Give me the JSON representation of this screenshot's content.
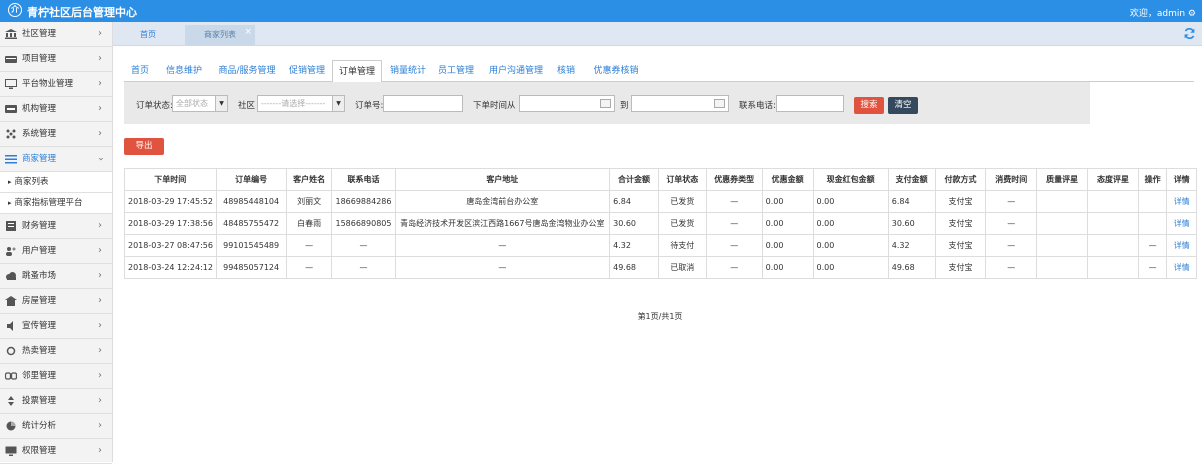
{
  "header": {
    "logo_glyph": "介",
    "title": "青柠社区后台管理中心",
    "welcome": "欢迎，admin ⚙"
  },
  "sidebar": {
    "items": [
      {
        "label": "社区管理",
        "icon": "bank-icon"
      },
      {
        "label": "项目管理",
        "icon": "card-icon"
      },
      {
        "label": "平台物业管理",
        "icon": "monitor-icon"
      },
      {
        "label": "机构管理",
        "icon": "badge-icon"
      },
      {
        "label": "系统管理",
        "icon": "grid-icon"
      },
      {
        "label": "商家管理",
        "icon": "list-icon",
        "active": true
      },
      {
        "label": "财务管理",
        "icon": "money-icon"
      },
      {
        "label": "用户管理",
        "icon": "users-icon"
      },
      {
        "label": "跳蚤市场",
        "icon": "cloud-icon"
      },
      {
        "label": "房屋管理",
        "icon": "house-icon"
      },
      {
        "label": "宣传管理",
        "icon": "speaker-icon"
      },
      {
        "label": "热卖管理",
        "icon": "sun-icon"
      },
      {
        "label": "邻里管理",
        "icon": "link-icon"
      },
      {
        "label": "投票管理",
        "icon": "updown-icon"
      },
      {
        "label": "统计分析",
        "icon": "pie-icon"
      },
      {
        "label": "权限管理",
        "icon": "screen-icon"
      }
    ],
    "subitems": [
      "商家列表",
      "商家指标管理平台"
    ]
  },
  "page_tabs": {
    "home": "首页",
    "current": "商家列表",
    "close": "×"
  },
  "subnav": [
    "首页",
    "信息维护",
    "商品/服务管理",
    "促销管理",
    "订单管理",
    "销量统计",
    "员工管理",
    "用户沟通管理",
    "核销",
    "优惠券核销"
  ],
  "subnav_active": "订单管理",
  "filter": {
    "status_label": "订单状态:",
    "status_value": "全部状态",
    "community_label": "社区",
    "community_value": "-------请选择-------",
    "order_no_label": "订单号:",
    "time_from_label": "下单时间从",
    "time_to_label": "到",
    "phone_label": "联系电话:",
    "search_label": "搜索",
    "clear_label": "清空"
  },
  "export_label": "导出",
  "table": {
    "columns": [
      "下单时间",
      "订单编号",
      "客户姓名",
      "联系电话",
      "客户地址",
      "合计金额",
      "订单状态",
      "优惠券类型",
      "优惠金额",
      "现金红包金额",
      "支付金额",
      "付款方式",
      "消费时间",
      "质量评星",
      "态度评星",
      "操作",
      "详情"
    ],
    "rows": [
      [
        "2018-03-29 17:45:52",
        "48985448104",
        "刘丽文",
        "18669884286",
        "唐岛金湾前台办公室",
        "6.84",
        "已发货",
        "—",
        "0.00",
        "0.00",
        "6.84",
        "支付宝",
        "—",
        "",
        "",
        "",
        "详情"
      ],
      [
        "2018-03-29 17:38:56",
        "48485755472",
        "白春雨",
        "15866890805",
        "青岛经济技术开发区滨江西路1667号唐岛金湾物业办公室",
        "30.60",
        "已发货",
        "—",
        "0.00",
        "0.00",
        "30.60",
        "支付宝",
        "—",
        "",
        "",
        "",
        "详情"
      ],
      [
        "2018-03-27 08:47:56",
        "99101545489",
        "—",
        "—",
        "—",
        "4.32",
        "待支付",
        "—",
        "0.00",
        "0.00",
        "4.32",
        "支付宝",
        "—",
        "",
        "",
        "—",
        "详情"
      ],
      [
        "2018-03-24 12:24:12",
        "99485057124",
        "—",
        "—",
        "—",
        "49.68",
        "已取消",
        "—",
        "0.00",
        "0.00",
        "49.68",
        "支付宝",
        "—",
        "",
        "",
        "—",
        "详情"
      ]
    ]
  },
  "pager": "第1页/共1页",
  "colors": {
    "brand": "#2b8fe6",
    "link": "#2b7fd6",
    "export": "#e0533f",
    "search": "#e0533f",
    "clear": "#34495e"
  }
}
